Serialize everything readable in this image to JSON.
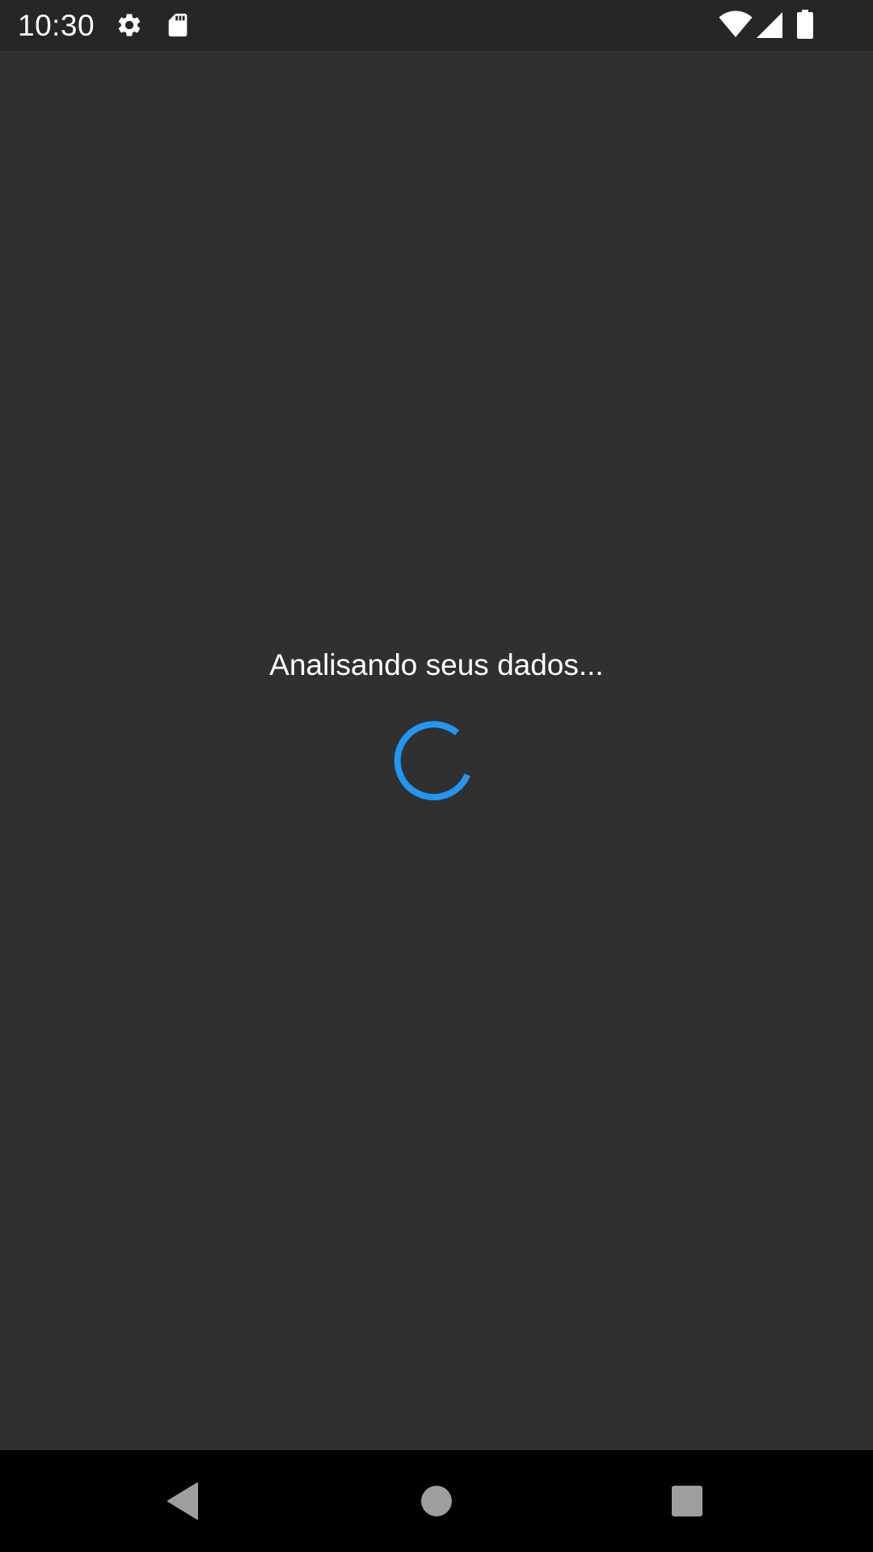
{
  "status_bar": {
    "time": "10:30",
    "icons": [
      "gear-icon",
      "sd-card-icon",
      "wifi-icon",
      "cell-signal-icon",
      "battery-icon"
    ]
  },
  "main": {
    "loading_text": "Analisando seus dados...",
    "spinner_color": "#2196F3",
    "background_color": "#303030"
  },
  "nav_bar": {
    "buttons": [
      "back-icon",
      "home-icon",
      "recents-icon"
    ]
  }
}
